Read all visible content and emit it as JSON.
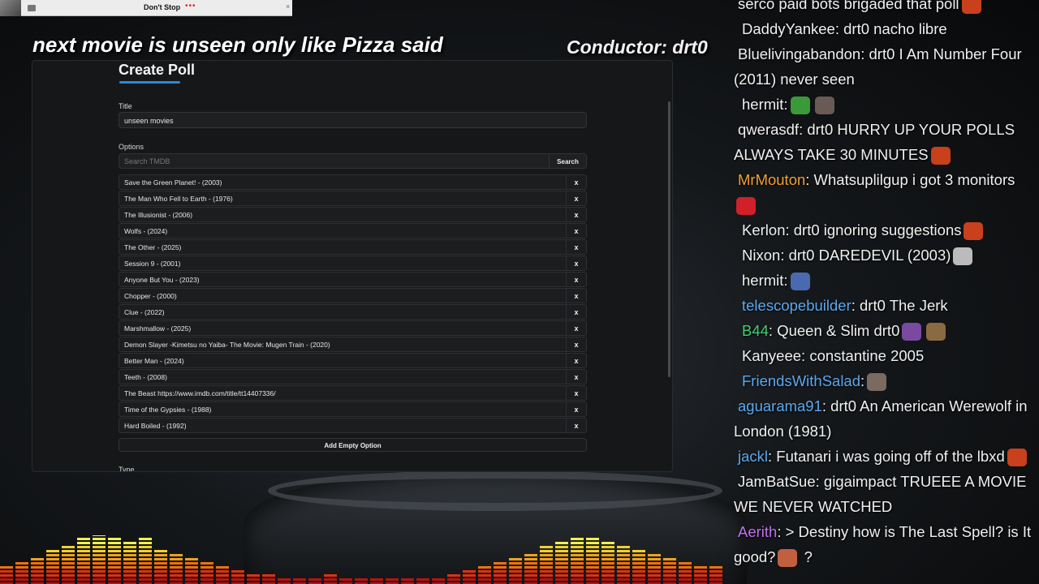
{
  "media": {
    "title": "Don't Stop",
    "dots": "•••",
    "close": "×"
  },
  "overlay": {
    "headline": "next movie is unseen only like Pizza said",
    "conductor": "Conductor: drt0"
  },
  "poll": {
    "heading": "Create Poll",
    "title_label": "Title",
    "title_value": "unseen movies",
    "options_label": "Options",
    "search_placeholder": "Search TMDB",
    "search_button": "Search",
    "remove_label": "x",
    "options": [
      "Save the Green Planet! - (2003)",
      "The Man Who Fell to Earth - (1976)",
      "The Illusionist - (2006)",
      "Wolfs - (2024)",
      "The Other - (2025)",
      "Session 9 - (2001)",
      "Anyone But You - (2023)",
      "Chopper - (2000)",
      "Clue - (2022)",
      "Marshmallow - (2025)",
      "Demon Slayer -Kimetsu no Yaiba- The Movie: Mugen Train - (2020)",
      "Better Man - (2024)",
      "Teeth - (2008)",
      "The Beast https://www.imdb.com/title/tt14407336/",
      "Time of the Gypsies - (1988)",
      "Hard Boiled - (1992)"
    ],
    "add_empty_option": "Add Empty Option",
    "type_label": "Type"
  },
  "chat": {
    "accent_colors": {
      "white": "#f0f0f0",
      "orange": "#f0a030",
      "blue": "#5aa8f0",
      "green": "#40d070",
      "rainbow": "#c070f0"
    },
    "messages": [
      {
        "user": "",
        "text": "serco paid bots brigaded that poll",
        "color": "#f0f0f0",
        "emotes": [
          "pepe-icon"
        ],
        "wrap": false
      },
      {
        "user": "DaddyYankee",
        "text": ": drt0 nacho libre",
        "color": "#f0f0f0",
        "emotes": [],
        "wrap": false
      },
      {
        "user": "Bluelivingabandon",
        "text": ": drt0 I Am Number Four (2011) never seen",
        "color": "#f0f0f0",
        "emotes": [],
        "wrap": true
      },
      {
        "user": "hermit",
        "text": ":",
        "color": "#f0f0f0",
        "emotes": [
          "frog-emote-icon",
          "bear-emote-icon"
        ],
        "wrap": false
      },
      {
        "user": "qwerasdf",
        "text": ": drt0 HURRY UP YOUR POLLS ALWAYS TAKE 30 MINUTES",
        "color": "#f0f0f0",
        "emotes": [
          "pepe-icon"
        ],
        "wrap": true
      },
      {
        "user": "MrMouton",
        "text": ": Whatsuplilgup i got 3 monitors",
        "color": "#f0a030",
        "emotes": [
          "red-face-emote-icon"
        ],
        "wrap": true
      },
      {
        "user": "Kerlon",
        "text": ": drt0 ignoring suggestions",
        "color": "#f0f0f0",
        "emotes": [
          "pepe-icon"
        ],
        "wrap": false
      },
      {
        "user": "Nixon",
        "text": ": drt0 DAREDEVIL (2003)",
        "color": "#f0f0f0",
        "emotes": [
          "skeleton-emote-icon"
        ],
        "wrap": false
      },
      {
        "user": "hermit",
        "text": ":",
        "color": "#f0f0f0",
        "emotes": [
          "cap-emote-icon"
        ],
        "wrap": false
      },
      {
        "user": "telescopebuilder",
        "text": ": drt0 The Jerk",
        "color": "#5aa8f0",
        "emotes": [],
        "wrap": false
      },
      {
        "user": "B44",
        "text": ": Queen & Slim drt0",
        "color": "#40d070",
        "emotes": [
          "witch-emote-icon",
          "face-emote-icon"
        ],
        "wrap": false
      },
      {
        "user": "Kanyeee",
        "text": ": constantine 2005",
        "color": "#f0f0f0",
        "emotes": [],
        "wrap": false
      },
      {
        "user": "FriendsWithSalad",
        "text": ":",
        "color": "#5aa8f0",
        "emotes": [
          "rock-emote-icon"
        ],
        "wrap": false
      },
      {
        "user": "aguarama91",
        "text": ": drt0 An American Werewolf in London (1981)",
        "color": "#5aa8f0",
        "emotes": [],
        "wrap": true
      },
      {
        "user": "jackl",
        "text": ": Futanari i was going off of the lbxd",
        "color": "#5aa8f0",
        "emotes": [
          "pepe-icon"
        ],
        "wrap": true
      },
      {
        "user": "JamBatSue",
        "text": ": gigaimpact TRUEEE A MOVIE WE NEVER WATCHED",
        "color": "#f0f0f0",
        "emotes": [],
        "wrap": true
      },
      {
        "user": "Aerith",
        "text": ": > Destiny how is The Last Spell? is It good?",
        "color": "#c070f0",
        "emotes": [
          "gun-emote-icon"
        ],
        "suffix": "?",
        "wrap": true
      }
    ]
  }
}
